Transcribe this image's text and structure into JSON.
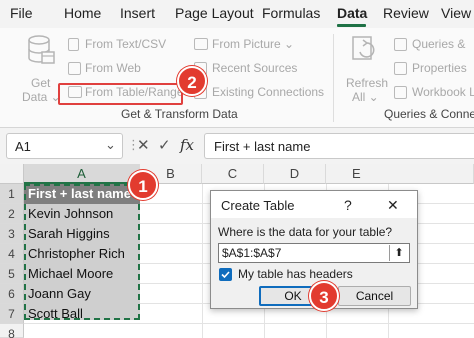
{
  "menu": {
    "tabs": [
      "File",
      "Home",
      "Insert",
      "Page Layout",
      "Formulas",
      "Data",
      "Review",
      "View"
    ],
    "active": "Data"
  },
  "ribbon": {
    "get_data": {
      "line1": "Get",
      "line2": "Data ⌄"
    },
    "from_text_csv": "From Text/CSV",
    "from_web": "From Web",
    "from_table_range": "From Table/Range",
    "from_picture": "From Picture ⌄",
    "recent_sources": "Recent Sources",
    "existing_connections": "Existing Connections",
    "group_get_transform": "Get & Transform Data",
    "refresh": {
      "line1": "Refresh",
      "line2": "All ⌄"
    },
    "queries_connections": "Queries &",
    "properties": "Properties",
    "workbook_links": "Workbook L",
    "group_queries": "Queries & Connect"
  },
  "formula_bar": {
    "name_box": "A1",
    "name_box_arrow": "⌄",
    "colon": "⋮",
    "cancel": "✕",
    "enter": "✓",
    "fx": "fx",
    "content": "First + last name"
  },
  "grid": {
    "columns": [
      "A",
      "B",
      "C",
      "D",
      "E"
    ],
    "rows": [
      "1",
      "2",
      "3",
      "4",
      "5",
      "6",
      "7",
      "8"
    ],
    "cells": [
      "First + last name",
      "Kevin Johnson",
      "Sarah Higgins",
      "Christopher Rich",
      "Michael Moore",
      "Joann Gay",
      "Scott Ball"
    ]
  },
  "dialog": {
    "title": "Create Table",
    "help": "?",
    "close": "✕",
    "prompt": "Where is the data for your table?",
    "range": "$A$1:$A$7",
    "collapse": "⬆",
    "checkbox_label": "My table has headers",
    "checkbox_checked": true,
    "ok": "OK",
    "cancel": "Cancel"
  },
  "badges": [
    "1",
    "2",
    "3"
  ],
  "colors": {
    "accent_green": "#1e7145",
    "badge_red": "#e23b2f",
    "selection_green": "#217346",
    "checkbox_blue": "#0f6cbd"
  }
}
